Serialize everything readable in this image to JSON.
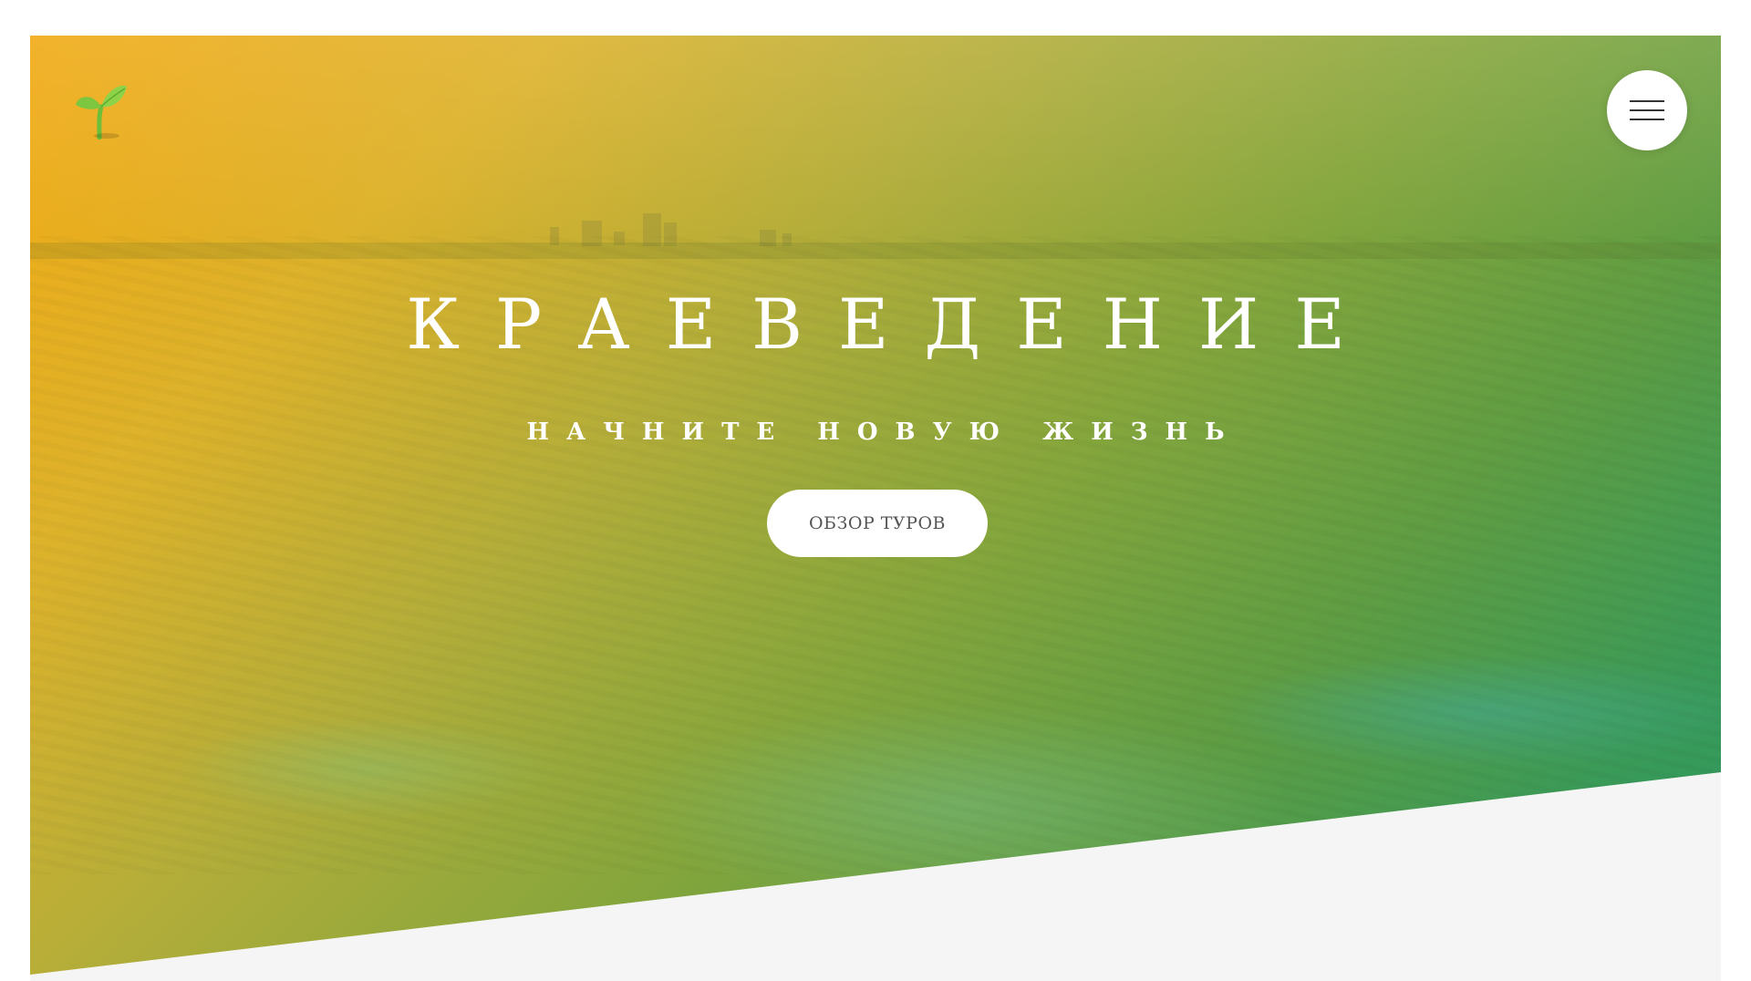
{
  "header": {
    "logo_icon": "sprout-logo-icon",
    "menu_icon": "hamburger-menu-icon"
  },
  "hero": {
    "title": "КРАЕВЕДЕНИЕ",
    "subtitle": "НАЧНИТЕ НОВУЮ ЖИЗНЬ",
    "cta_label": "ОБЗОР ТУРОВ"
  },
  "colors": {
    "gradient_start": "#f1aa14",
    "gradient_end": "#2a9860",
    "button_bg": "#ffffff",
    "page_bg": "#f5f5f5"
  }
}
